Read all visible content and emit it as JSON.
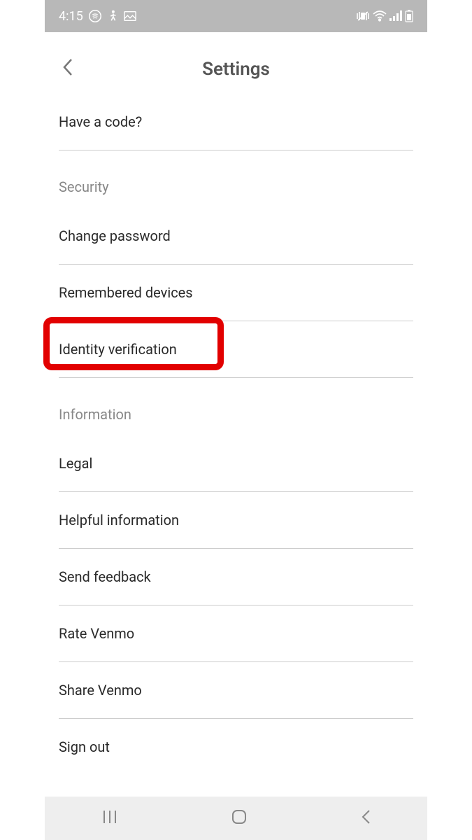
{
  "status": {
    "time": "4:15"
  },
  "header": {
    "title": "Settings"
  },
  "items": {
    "have_code": "Have a code?",
    "security_label": "Security",
    "change_password": "Change password",
    "remembered_devices": "Remembered devices",
    "identity_verification": "Identity verification",
    "information_label": "Information",
    "legal": "Legal",
    "helpful_information": "Helpful information",
    "send_feedback": "Send feedback",
    "rate_venmo": "Rate Venmo",
    "share_venmo": "Share Venmo",
    "sign_out": "Sign out"
  }
}
